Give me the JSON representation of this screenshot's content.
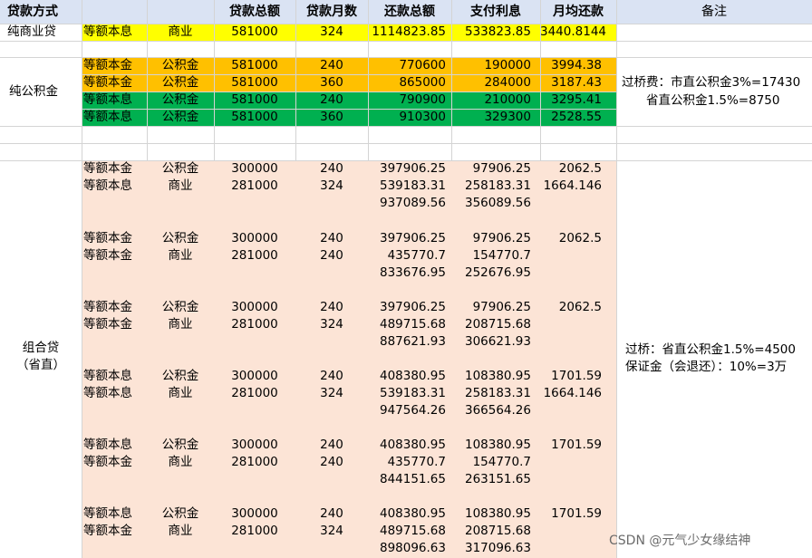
{
  "header": {
    "method": "贷款方式",
    "amount": "贷款总额",
    "months": "贷款月数",
    "total": "还款总额",
    "interest": "支付利息",
    "monthly": "月均还款",
    "note": "备注"
  },
  "pure_commercial": {
    "label": "纯商业贷",
    "row": {
      "repay": "等额本息",
      "type": "商业",
      "amount": "581000",
      "months": "324",
      "total": "1114823.85",
      "interest": "533823.85",
      "monthly": "3440.8144"
    }
  },
  "pure_fund": {
    "label": "纯公积金",
    "rows": [
      {
        "repay": "等额本金",
        "type": "公积金",
        "amount": "581000",
        "months": "240",
        "total": "770600",
        "interest": "190000",
        "monthly": "3994.38"
      },
      {
        "repay": "等额本金",
        "type": "公积金",
        "amount": "581000",
        "months": "360",
        "total": "865000",
        "interest": "284000",
        "monthly": "3187.43"
      },
      {
        "repay": "等额本息",
        "type": "公积金",
        "amount": "581000",
        "months": "240",
        "total": "790900",
        "interest": "210000",
        "monthly": "3295.41"
      },
      {
        "repay": "等额本息",
        "type": "公积金",
        "amount": "581000",
        "months": "360",
        "total": "910300",
        "interest": "329300",
        "monthly": "2528.55"
      }
    ],
    "note_line1": "过桥费：市直公积金3%=17430",
    "note_line2": "省直公积金1.5%=8750"
  },
  "combo": {
    "label": "组合贷\n（省直）",
    "note_line1": "过桥：省直公积金1.5%=4500",
    "note_line2": "保证金（会退还）：10%=3万",
    "groups": [
      {
        "repay": [
          "等额本金",
          "等额本息"
        ],
        "type": [
          "公积金",
          "商业"
        ],
        "amount": [
          "300000",
          "281000"
        ],
        "months": [
          "240",
          "324"
        ],
        "total": [
          "397906.25",
          "539183.31",
          "937089.56"
        ],
        "interest": [
          "97906.25",
          "258183.31",
          "356089.56"
        ],
        "monthly": [
          "2062.5",
          "1664.146"
        ]
      },
      {
        "repay": [
          "等额本金",
          "等额本金"
        ],
        "type": [
          "公积金",
          "商业"
        ],
        "amount": [
          "300000",
          "281000"
        ],
        "months": [
          "240",
          "240"
        ],
        "total": [
          "397906.25",
          "435770.7",
          "833676.95"
        ],
        "interest": [
          "97906.25",
          "154770.7",
          "252676.95"
        ],
        "monthly": [
          "2062.5",
          ""
        ]
      },
      {
        "repay": [
          "等额本金",
          "等额本金"
        ],
        "type": [
          "公积金",
          "商业"
        ],
        "amount": [
          "300000",
          "281000"
        ],
        "months": [
          "240",
          "324"
        ],
        "total": [
          "397906.25",
          "489715.68",
          "887621.93"
        ],
        "interest": [
          "97906.25",
          "208715.68",
          "306621.93"
        ],
        "monthly": [
          "2062.5",
          ""
        ]
      },
      {
        "repay": [
          "等额本息",
          "等额本息"
        ],
        "type": [
          "公积金",
          "商业"
        ],
        "amount": [
          "300000",
          "281000"
        ],
        "months": [
          "240",
          "324"
        ],
        "total": [
          "408380.95",
          "539183.31",
          "947564.26"
        ],
        "interest": [
          "108380.95",
          "258183.31",
          "366564.26"
        ],
        "monthly": [
          "1701.59",
          "1664.146"
        ]
      },
      {
        "repay": [
          "等额本息",
          "等额本金"
        ],
        "type": [
          "公积金",
          "商业"
        ],
        "amount": [
          "300000",
          "281000"
        ],
        "months": [
          "240",
          "240"
        ],
        "total": [
          "408380.95",
          "435770.7",
          "844151.65"
        ],
        "interest": [
          "108380.95",
          "154770.7",
          "263151.65"
        ],
        "monthly": [
          "1701.59",
          ""
        ]
      },
      {
        "repay": [
          "等额本息",
          "等额本金"
        ],
        "type": [
          "公积金",
          "商业"
        ],
        "amount": [
          "300000",
          "281000"
        ],
        "months": [
          "240",
          "324"
        ],
        "total": [
          "408380.95",
          "489715.68",
          "898096.63"
        ],
        "interest": [
          "108380.95",
          "208715.68",
          "317096.63"
        ],
        "monthly": [
          "1701.59",
          ""
        ]
      }
    ]
  },
  "watermark": "CSDN @元气少女缘结神",
  "colors": {
    "header_bg": "#dae3f3",
    "yellow": "#ffff00",
    "orange": "#ffc000",
    "green": "#00b050",
    "peach": "#fce4d6"
  }
}
